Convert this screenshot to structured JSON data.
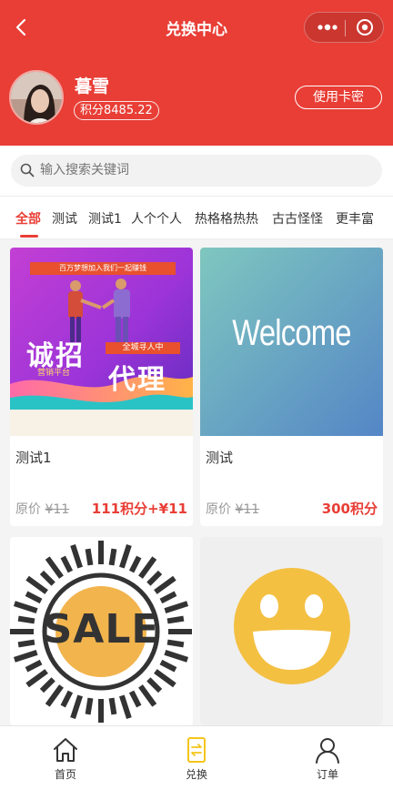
{
  "header": {
    "title": "兑换中心"
  },
  "user": {
    "name": "暮雪",
    "points": "积分8485.22",
    "redeem_label": "使用卡密"
  },
  "search": {
    "placeholder": "输入搜索关键词"
  },
  "tabs": [
    {
      "label": "全部",
      "active": true
    },
    {
      "label": "测试"
    },
    {
      "label": "测试1"
    },
    {
      "label": "人个个人"
    },
    {
      "label": "热格格热热"
    },
    {
      "label": "古古怪怪"
    },
    {
      "label": "更丰富"
    }
  ],
  "products": [
    {
      "name": "测试1",
      "orig_prefix": "原价",
      "orig_price": "¥11",
      "price": "111积分+¥11",
      "image": {
        "top_banner": "百万梦想加入我们一起赚钱",
        "big_left": "诚招",
        "big_right": "代理",
        "tag": "全城寻人中",
        "sub": "营销平台"
      }
    },
    {
      "name": "测试",
      "orig_prefix": "原价",
      "orig_price": "¥11",
      "price": "300积分",
      "image": {
        "text": "Welcome"
      }
    },
    {
      "image": {
        "text": "SALE"
      }
    },
    {
      "image": {
        "icon": "smiley-face"
      }
    }
  ],
  "tabbar": [
    {
      "label": "首页",
      "icon": "home-icon"
    },
    {
      "label": "兑换",
      "icon": "exchange-icon",
      "active": true
    },
    {
      "label": "订单",
      "icon": "user-icon"
    }
  ],
  "colors": {
    "brand": "#e83e36",
    "active_tab_icon": "#f5c518"
  }
}
